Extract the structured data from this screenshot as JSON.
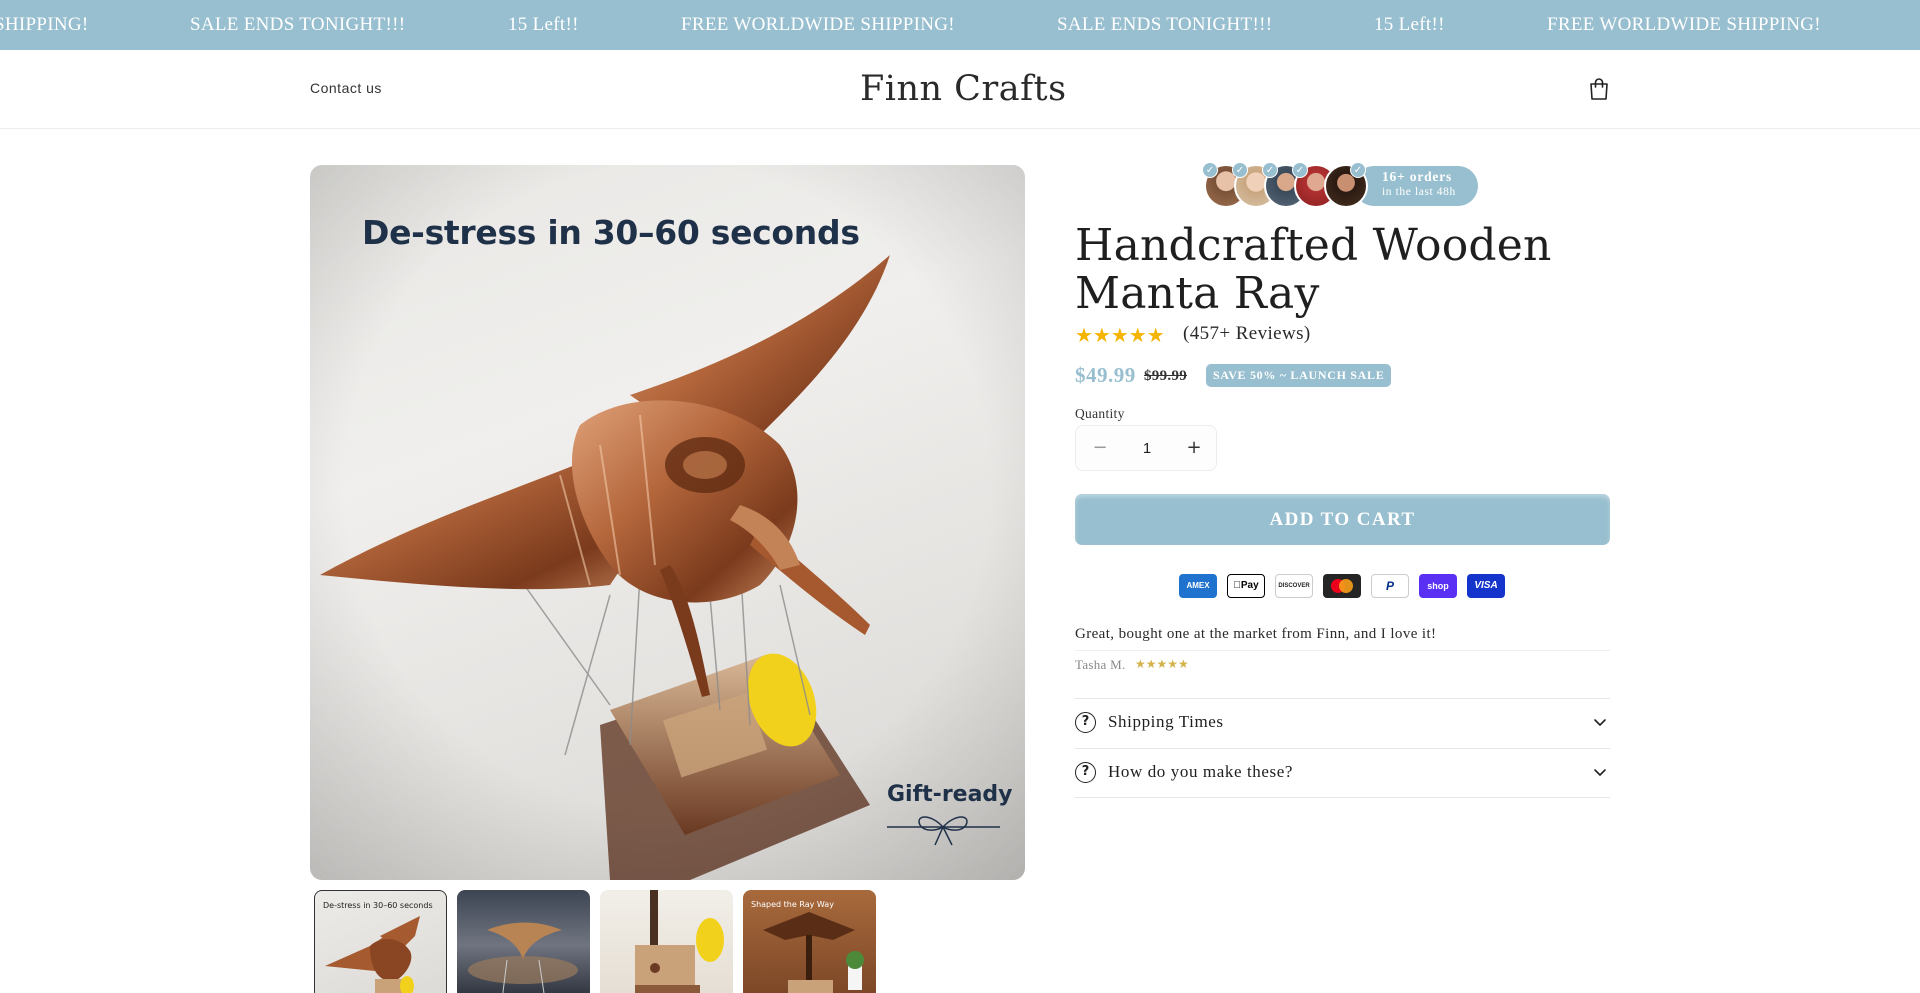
{
  "announcement": {
    "messages": [
      "SHIPPING!",
      "SALE ENDS TONIGHT!!!",
      "15 Left!!",
      "FREE WORLDWIDE SHIPPING!",
      "SALE ENDS TONIGHT!!!",
      "15 Left!!",
      "FREE WORLDWIDE SHIPPING!"
    ]
  },
  "header": {
    "contact_label": "Contact us",
    "brand": "Finn Crafts",
    "cart_icon": "bag-icon"
  },
  "gallery": {
    "main_image_headline": "De-stress in 30–60 seconds",
    "main_image_badge": "Gift-ready",
    "thumbnails": [
      {
        "caption": "De-stress in 30–60 seconds",
        "active": true
      },
      {
        "caption": "",
        "active": false
      },
      {
        "caption": "",
        "active": false
      },
      {
        "caption": "Shaped the Ray Way",
        "active": false
      }
    ]
  },
  "social_proof": {
    "orders": "16+ orders",
    "window": "in the last 48h"
  },
  "product": {
    "title": "Handcrafted Wooden Manta Ray",
    "rating_stars": "★★★★★",
    "rating_value": 4.5,
    "reviews_label": "(457+ Reviews)",
    "price": "$49.99",
    "compare_price": "$99.99",
    "sale_badge": "SAVE 50% ~ LAUNCH SALE",
    "quantity_label": "Quantity",
    "quantity_value": "1",
    "minus_symbol": "−",
    "plus_symbol": "+",
    "add_to_cart": "ADD TO CART"
  },
  "payments": [
    {
      "name": "AMEX",
      "bg": "#1f72cd",
      "fg": "#ffffff"
    },
    {
      "name": "Pay",
      "bg": "#ffffff",
      "fg": "#000000"
    },
    {
      "name": "DISCOVER",
      "bg": "#ffffff",
      "fg": "#231f20"
    },
    {
      "name": "",
      "bg": "#252525",
      "fg": "#ffffff"
    },
    {
      "name": "P",
      "bg": "#ffffff",
      "fg": "#003087"
    },
    {
      "name": "shop",
      "bg": "#5a31f4",
      "fg": "#ffffff"
    },
    {
      "name": "VISA",
      "bg": "#1434cb",
      "fg": "#ffffff"
    }
  ],
  "review": {
    "text": "Great, bought one at the market from Finn, and I love it!",
    "author": "Tasha M.",
    "stars": "★★★★★"
  },
  "accordions": [
    {
      "label": "Shipping Times",
      "icon": "question-circle-icon"
    },
    {
      "label": "How do you make these?",
      "icon": "question-circle-icon"
    }
  ],
  "colors": {
    "accent": "#98bfcf",
    "star": "#f4b400"
  }
}
